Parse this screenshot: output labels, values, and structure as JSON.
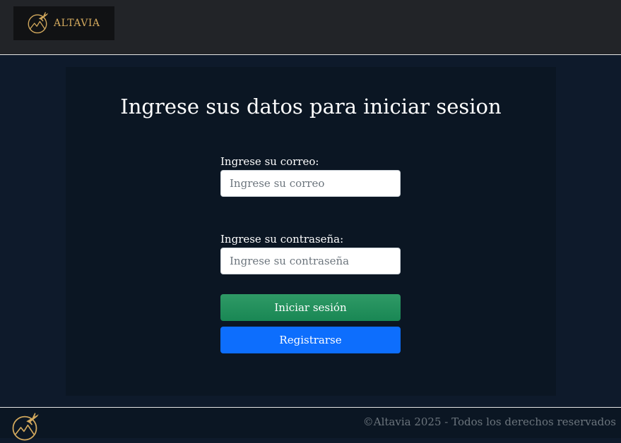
{
  "header": {
    "brand": "ALTAVIA",
    "logo_icon": "plane-mountain-logo-icon"
  },
  "login": {
    "title": "Ingrese sus datos para iniciar sesion",
    "email_label": "Ingrese su correo:",
    "email_placeholder": "Ingrese su correo",
    "email_value": "",
    "password_label": "Ingrese su contraseña:",
    "password_placeholder": "Ingrese su contraseña",
    "password_value": "",
    "login_button": "Iniciar sesión",
    "register_button": "Registrarse"
  },
  "footer": {
    "copyright": "©Altavia 2025 - Todos los derechos reservados",
    "logo_icon": "plane-mountain-logo-icon"
  },
  "colors": {
    "header_bg": "#222428",
    "page_bg": "#0e1a2b",
    "card_bg": "#0b1623",
    "brand_gold": "#d4aa5e",
    "login_green": "#198754",
    "register_blue": "#0d6efd"
  }
}
